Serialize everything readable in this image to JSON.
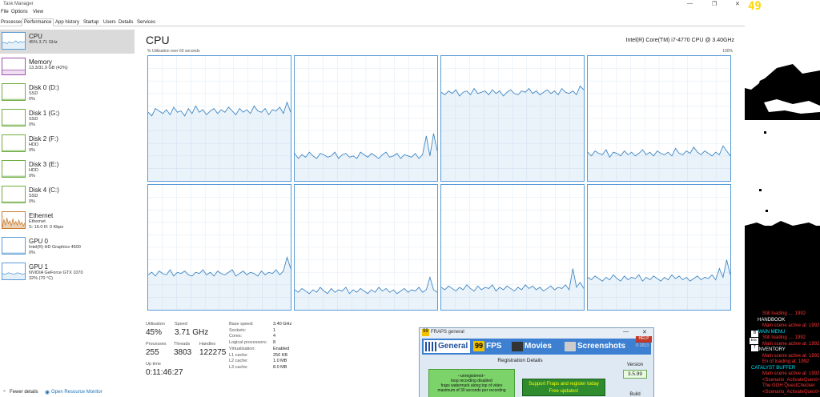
{
  "window": {
    "title": "Task Manager",
    "controls": [
      "—",
      "❐",
      "✕"
    ]
  },
  "menu": [
    "File",
    "Options",
    "View"
  ],
  "tabs": [
    "Processes",
    "Performance",
    "App history",
    "Startup",
    "Users",
    "Details",
    "Services"
  ],
  "active_tab": "Performance",
  "sidebar": [
    {
      "name": "CPU",
      "lines": [
        "45% 3.71 GHz"
      ],
      "color": "#5a9bd5"
    },
    {
      "name": "Memory",
      "lines": [
        "13.3/31.9 GB (42%)"
      ],
      "color": "#a04fb0"
    },
    {
      "name": "Disk 0 (D:)",
      "lines": [
        "SSD",
        "0%"
      ],
      "color": "#6fae3d"
    },
    {
      "name": "Disk 1 (G:)",
      "lines": [
        "SSD",
        "0%"
      ],
      "color": "#6fae3d"
    },
    {
      "name": "Disk 2 (F:)",
      "lines": [
        "HDD",
        "0%"
      ],
      "color": "#6fae3d"
    },
    {
      "name": "Disk 3 (E:)",
      "lines": [
        "HDD",
        "0%"
      ],
      "color": "#6fae3d"
    },
    {
      "name": "Disk 4 (C:)",
      "lines": [
        "SSD",
        "0%"
      ],
      "color": "#6fae3d"
    },
    {
      "name": "Ethernet",
      "lines": [
        "Ethernet",
        "S: 16.0  R: 0 Kbps"
      ],
      "color": "#c77b2e"
    },
    {
      "name": "GPU 0",
      "lines": [
        "Intel(R) HD Graphics 4600",
        "0%"
      ],
      "color": "#5a9bd5"
    },
    {
      "name": "GPU 1",
      "lines": [
        "NVIDIA GeForce GTX 1070",
        "32% (70 °C)"
      ],
      "color": "#5a9bd5"
    }
  ],
  "main": {
    "title": "CPU",
    "model": "Intel(R) Core(TM) i7-4770 CPU @ 3.40GHz",
    "util_label": "% Utilisation over 60 seconds",
    "util_max": "100%"
  },
  "chart_data": {
    "type": "line",
    "series": [
      {
        "values": [
          55,
          52,
          58,
          56,
          54,
          57,
          53,
          59,
          55,
          56,
          52,
          58,
          54,
          60,
          55,
          57,
          53,
          56,
          58,
          54,
          57,
          55,
          59,
          56,
          53,
          58,
          55,
          57,
          54,
          60,
          56,
          55,
          58,
          53,
          57,
          56,
          59,
          54,
          63,
          55
        ]
      },
      {
        "values": [
          22,
          18,
          21,
          19,
          23,
          20,
          18,
          22,
          21,
          19,
          20,
          23,
          18,
          21,
          22,
          19,
          20,
          18,
          23,
          21,
          19,
          22,
          20,
          18,
          21,
          23,
          19,
          20,
          22,
          18,
          21,
          20,
          19,
          22,
          18,
          21,
          36,
          20,
          38,
          24
        ]
      },
      {
        "values": [
          71,
          69,
          72,
          70,
          73,
          68,
          71,
          72,
          69,
          74,
          70,
          71,
          72,
          69,
          73,
          70,
          72,
          68,
          71,
          73,
          70,
          69,
          72,
          71,
          74,
          70,
          72,
          69,
          71,
          73,
          70,
          72,
          69,
          74,
          71,
          70,
          72,
          69,
          76,
          73
        ]
      },
      {
        "values": [
          23,
          20,
          24,
          22,
          21,
          25,
          19,
          23,
          22,
          20,
          24,
          21,
          23,
          20,
          22,
          25,
          21,
          23,
          20,
          24,
          22,
          21,
          23,
          20,
          26,
          22,
          21,
          24,
          22,
          27,
          23,
          21,
          24,
          22,
          20,
          23,
          21,
          28,
          24,
          20
        ]
      },
      {
        "values": [
          28,
          30,
          27,
          31,
          29,
          28,
          32,
          27,
          30,
          29,
          31,
          28,
          27,
          30,
          29,
          32,
          28,
          30,
          27,
          31,
          29,
          28,
          30,
          32,
          27,
          29,
          31,
          28,
          30,
          29,
          27,
          31,
          28,
          30,
          29,
          32,
          28,
          31,
          42,
          33
        ]
      },
      {
        "values": [
          16,
          14,
          17,
          15,
          13,
          16,
          14,
          18,
          15,
          13,
          17,
          14,
          16,
          15,
          18,
          13,
          16,
          14,
          17,
          15,
          13,
          16,
          14,
          18,
          15,
          17,
          14,
          16,
          13,
          15,
          17,
          14,
          16,
          15,
          18,
          14,
          16,
          26,
          16,
          14
        ]
      },
      {
        "values": [
          18,
          16,
          19,
          17,
          15,
          18,
          16,
          20,
          17,
          15,
          19,
          16,
          18,
          17,
          20,
          15,
          18,
          16,
          19,
          17,
          15,
          18,
          16,
          20,
          17,
          19,
          16,
          18,
          15,
          17,
          19,
          16,
          18,
          17,
          20,
          16,
          33,
          18,
          22,
          17
        ]
      },
      {
        "values": [
          26,
          24,
          27,
          25,
          23,
          26,
          24,
          28,
          25,
          23,
          27,
          24,
          26,
          25,
          28,
          23,
          26,
          24,
          27,
          25,
          23,
          26,
          24,
          28,
          25,
          27,
          24,
          26,
          23,
          25,
          27,
          24,
          26,
          25,
          28,
          24,
          33,
          26,
          40,
          28
        ]
      }
    ],
    "ylim": [
      0,
      100
    ]
  },
  "stats": {
    "utilisation_label": "Utilisation",
    "utilisation": "45%",
    "speed_label": "Speed",
    "speed": "3.71 GHz",
    "processes_label": "Processes",
    "processes": "255",
    "threads_label": "Threads",
    "threads": "3803",
    "handles_label": "Handles",
    "handles": "122275",
    "uptime_label": "Up time",
    "uptime": "0:11:46:27",
    "details": [
      {
        "k": "Base speed:",
        "v": "3.40 GHz"
      },
      {
        "k": "Sockets:",
        "v": "1"
      },
      {
        "k": "Cores:",
        "v": "4"
      },
      {
        "k": "Logical processors:",
        "v": "8"
      },
      {
        "k": "Virtualisation:",
        "v": "Enabled"
      },
      {
        "k": "L1 cache:",
        "v": "256 KB"
      },
      {
        "k": "L2 cache:",
        "v": "1.0 MB"
      },
      {
        "k": "L3 cache:",
        "v": "8.0 MB"
      }
    ]
  },
  "bottom": {
    "fewer": "Fewer details",
    "open_rm": "Open Resource Monitor"
  },
  "fraps": {
    "title": "FRAPS general",
    "tabs": [
      "General",
      "FPS",
      "Movies",
      "Screenshots"
    ],
    "fps_badge": "99",
    "help": "HELP",
    "copyright": "© 2013",
    "reg_title": "Registration Details",
    "unreg": [
      "--unregistered--",
      "loop recording disabled",
      "fraps watermark along top of video",
      "maximum of 30 seconds per recording"
    ],
    "support": [
      "Support Fraps and register today",
      "Free updates!"
    ],
    "version_label": "Version",
    "version": "3.5.99",
    "build_label": "Build"
  },
  "game": {
    "fps": "49",
    "log": [
      {
        "text": "Still loading .... 1992",
        "color": "#ff3333"
      },
      {
        "text": "HANDBOOK",
        "color": "#ffffff"
      },
      {
        "text": "Main scene active at: 1992",
        "color": "#ff3333"
      },
      {
        "text": "MAIN MENU",
        "color": "#00e5ff"
      },
      {
        "text": "Still loading .... 1992",
        "color": "#ff3333"
      },
      {
        "text": "Main scene active at: 1992",
        "color": "#ff3333"
      },
      {
        "text": "INVENTORY",
        "color": "#ffffff"
      },
      {
        "text": "Main scene active at: 1992",
        "color": "#ff3333"
      },
      {
        "text": "En of loading at: 1992",
        "color": "#ff3333"
      },
      {
        "text": "CATALYST BUFFER",
        "color": "#00e5ff"
      },
      {
        "text": "Main scene active at: 1992",
        "color": "#ff3333"
      },
      {
        "text": "<Scenario_ActivateQuest>",
        "color": "#ff3333"
      },
      {
        "text": "The GOH  QuestChecker",
        "color": "#ff3333"
      },
      {
        "text": "<Scenario_ActivateQuest>",
        "color": "#ff3333"
      }
    ],
    "keys": [
      "B",
      "Esc",
      "T"
    ]
  }
}
